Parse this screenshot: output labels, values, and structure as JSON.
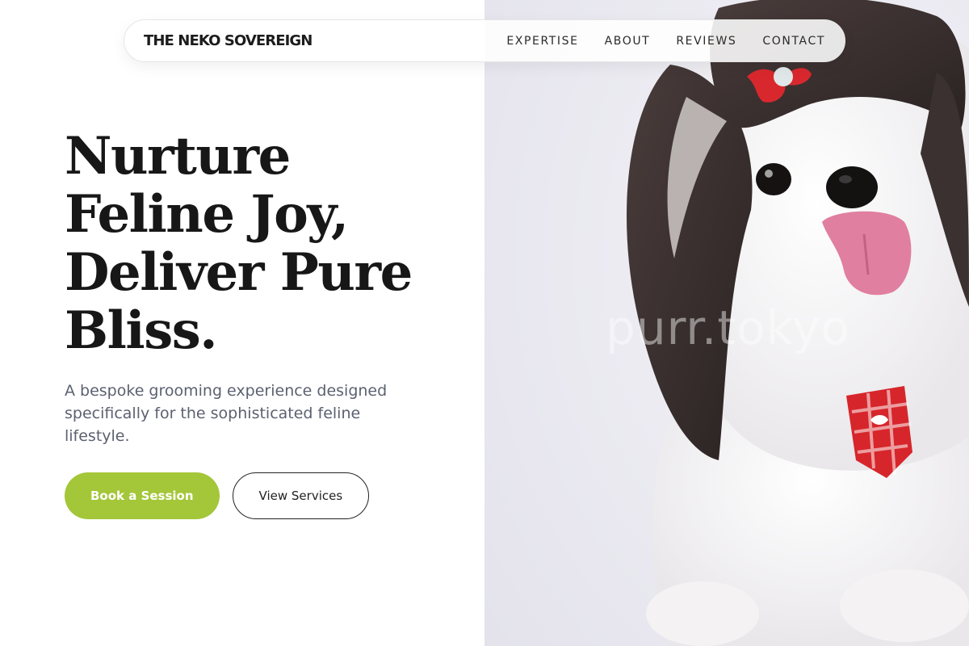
{
  "nav": {
    "brand": "THE NEKO SOVEREIGN",
    "links": [
      "EXPERTISE",
      "ABOUT",
      "REVIEWS",
      "CONTACT"
    ]
  },
  "hero": {
    "headline_lines": [
      "Nurture",
      "Feline Joy,",
      "Deliver Pure",
      "Bliss."
    ],
    "subheadline": "A bespoke grooming experience designed specifically for the sophisticated feline lifestyle.",
    "primary_cta": "Book a Session",
    "secondary_cta": "View Services",
    "image_watermark": "purr.tokyo"
  },
  "colors": {
    "accent": "#a4c639",
    "text_dark": "#171717",
    "text_muted": "#5b6170",
    "image_bg": "#ebeaf1"
  }
}
